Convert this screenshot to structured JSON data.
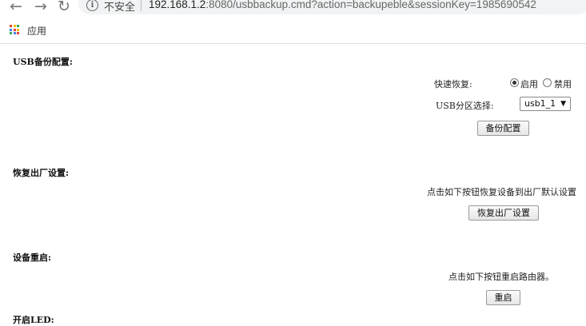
{
  "browser": {
    "security_label": "不安全",
    "url_host": "192.168.1.2",
    "url_rest": ":8080/usbbackup.cmd?action=backupeble&sessionKey=1985690542",
    "bookmarks_apps_label": "应用",
    "icons": [
      "back-icon",
      "forward-icon",
      "reload-icon",
      "info-icon",
      "apps-grid-icon"
    ]
  },
  "usb_backup": {
    "title": "USB备份配置:",
    "quick_restore_label": "快速恢复:",
    "enable_label": "启用",
    "disable_label": "禁用",
    "selected": "enable",
    "partition_label": "USB分区选择:",
    "partition_value": "usb1_1",
    "backup_button": "备份配置"
  },
  "factory_reset": {
    "title": "恢复出厂设置:",
    "hint": "点击如下按钮恢复设备到出厂默认设置",
    "button": "恢复出厂设置"
  },
  "reboot": {
    "title": "设备重启:",
    "hint": "点击如下按钮重启路由器。",
    "button": "重启"
  },
  "led": {
    "title_partial": "开启LED:"
  }
}
